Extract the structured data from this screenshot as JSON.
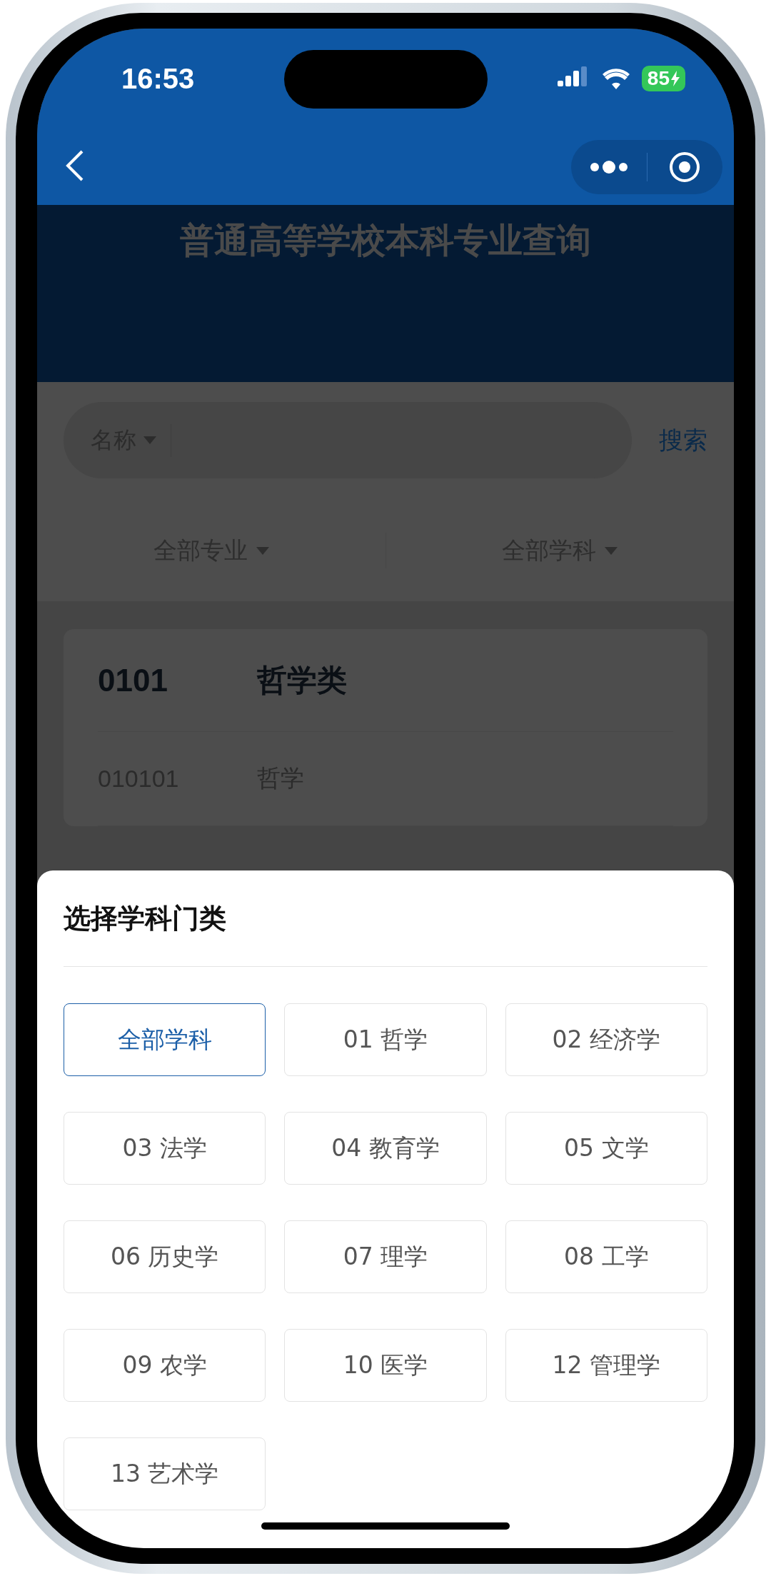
{
  "status_bar": {
    "time": "16:53",
    "battery": "85"
  },
  "header": {
    "title": "普通高等学校本科专业查询"
  },
  "search": {
    "field_type": "名称",
    "button": "搜索"
  },
  "filters": [
    {
      "label": "全部专业"
    },
    {
      "label": "全部学科"
    }
  ],
  "card": {
    "code": "0101",
    "name": "哲学类",
    "rows": [
      {
        "code": "010101",
        "name": "哲学"
      }
    ]
  },
  "sheet": {
    "title": "选择学科门类",
    "options": [
      {
        "label": "全部学科",
        "selected": true
      },
      {
        "label": "01 哲学",
        "selected": false
      },
      {
        "label": "02 经济学",
        "selected": false
      },
      {
        "label": "03 法学",
        "selected": false
      },
      {
        "label": "04 教育学",
        "selected": false
      },
      {
        "label": "05 文学",
        "selected": false
      },
      {
        "label": "06 历史学",
        "selected": false
      },
      {
        "label": "07 理学",
        "selected": false
      },
      {
        "label": "08 工学",
        "selected": false
      },
      {
        "label": "09 农学",
        "selected": false
      },
      {
        "label": "10 医学",
        "selected": false
      },
      {
        "label": "12 管理学",
        "selected": false
      },
      {
        "label": "13 艺术学",
        "selected": false
      }
    ]
  }
}
